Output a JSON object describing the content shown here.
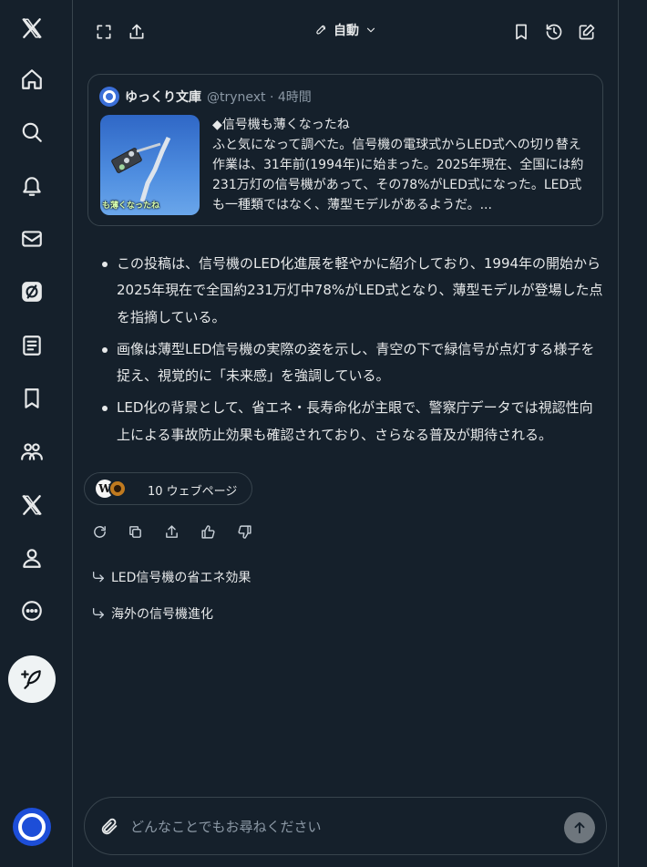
{
  "sidebar": {
    "items": [
      {
        "name": "x-logo-icon",
        "label": "X"
      },
      {
        "name": "home-icon",
        "label": "Home"
      },
      {
        "name": "search-icon",
        "label": "Explore"
      },
      {
        "name": "bell-icon",
        "label": "Notifications"
      },
      {
        "name": "mail-icon",
        "label": "Messages"
      },
      {
        "name": "grok-icon",
        "label": "Grok"
      },
      {
        "name": "list-icon",
        "label": "Lists"
      },
      {
        "name": "bookmark-icon",
        "label": "Bookmarks"
      },
      {
        "name": "communities-icon",
        "label": "Communities"
      },
      {
        "name": "x-premium-icon",
        "label": "Premium"
      },
      {
        "name": "profile-icon",
        "label": "Profile"
      },
      {
        "name": "more-icon",
        "label": "More"
      }
    ],
    "compose_icon": "feather-plus-icon"
  },
  "toolbar": {
    "mode_label": "自動",
    "left_icons": [
      "expand-icon",
      "share-icon"
    ],
    "right_icons": [
      "bookmark-icon",
      "history-icon",
      "new-chat-icon"
    ]
  },
  "quote": {
    "author_name": "ゆっくり文庫",
    "meta": "@trynext · 4時間",
    "thumb_caption": "も薄くなったね",
    "text": "◆信号機も薄くなったね\nふと気になって調べた。信号機の電球式からLED式への切り替え作業は、31年前(1994年)に始まった。2025年現在、全国には約231万灯の信号機があって、その78%がLED式になった。LED式も一種類ではなく、薄型モデルがあるようだ。..."
  },
  "bullets": [
    "この投稿は、信号機のLED化進展を軽やかに紹介しており、1994年の開始から2025年現在で全国約231万灯中78%がLED式となり、薄型モデルが登場した点を指摘している。",
    "画像は薄型LED信号機の実際の姿を示し、青空の下で緑信号が点灯する様子を捉え、視覚的に「未来感」を強調している。",
    "LED化の背景として、省エネ・長寿命化が主眼で、警察庁データでは視認性向上による事故防止効果も確認されており、さらなる普及が期待される。"
  ],
  "sources": {
    "label": "10 ウェブページ",
    "w_glyph": "W"
  },
  "actions": [
    "regenerate-icon",
    "copy-icon",
    "share-icon",
    "thumbs-up-icon",
    "thumbs-down-icon"
  ],
  "followups": [
    "LED信号機の省エネ効果",
    "海外の信号機進化"
  ],
  "input": {
    "placeholder": "どんなことでもお尋ねください"
  },
  "colors": {
    "background": "#15202b",
    "border": "#38444d",
    "text": "#e7e9ea",
    "muted": "#8b98a5"
  }
}
